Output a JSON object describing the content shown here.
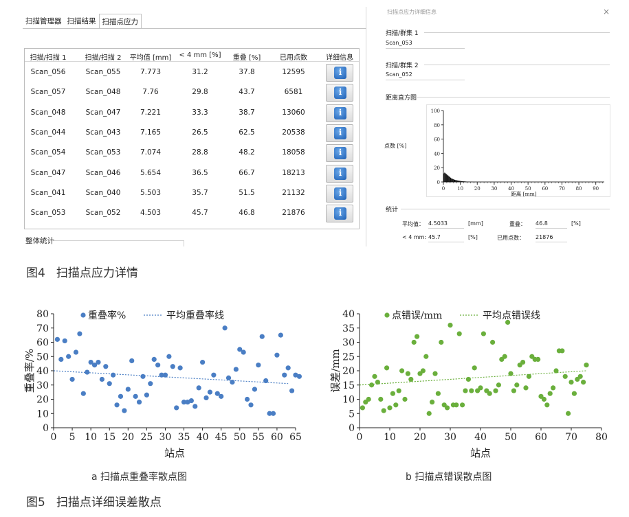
{
  "figure4": {
    "tabs": [
      "扫描管理器",
      "扫描结果",
      "扫描点应力"
    ],
    "active_tab": 2,
    "columns": [
      "扫描/扫描 1",
      "扫描/扫描 2",
      "平均值 [mm]",
      "< 4 mm [%]",
      "重叠 [%]",
      "已用点数",
      "详细信息"
    ],
    "rows": [
      {
        "scan1": "Scan_056",
        "scan2": "Scan_055",
        "mean": "7.773",
        "lt4": "31.2",
        "overlap": "37.8",
        "points": "12595"
      },
      {
        "scan1": "Scan_057",
        "scan2": "Scan_048",
        "mean": "7.76",
        "lt4": "29.8",
        "overlap": "43.7",
        "points": "6581"
      },
      {
        "scan1": "Scan_048",
        "scan2": "Scan_047",
        "mean": "7.221",
        "lt4": "33.3",
        "overlap": "38.7",
        "points": "13060"
      },
      {
        "scan1": "Scan_044",
        "scan2": "Scan_043",
        "mean": "7.165",
        "lt4": "26.5",
        "overlap": "62.5",
        "points": "20538"
      },
      {
        "scan1": "Scan_054",
        "scan2": "Scan_053",
        "mean": "7.074",
        "lt4": "28.8",
        "overlap": "48.2",
        "points": "18058"
      },
      {
        "scan1": "Scan_047",
        "scan2": "Scan_046",
        "mean": "5.654",
        "lt4": "36.5",
        "overlap": "66.7",
        "points": "18213"
      },
      {
        "scan1": "Scan_041",
        "scan2": "Scan_040",
        "mean": "5.503",
        "lt4": "35.7",
        "overlap": "51.5",
        "points": "21132"
      },
      {
        "scan1": "Scan_053",
        "scan2": "Scan_052",
        "mean": "4.503",
        "lt4": "45.7",
        "overlap": "46.8",
        "points": "21876"
      }
    ],
    "info_glyph": "i",
    "overall_stats_label": "整体统计",
    "detail": {
      "window_title": "扫描点应力详细信息",
      "close_glyph": "×",
      "scan1_label": "扫描/群集 1",
      "scan1_value": "Scan_053",
      "scan2_label": "扫描/群集 2",
      "scan2_value": "Scan_052",
      "histogram_label": "距离直方图",
      "histogram": {
        "ylabel": "点数 [%]",
        "xlabel": "距离 [mm]",
        "yticks": [
          "0",
          "20",
          "40",
          "60",
          "80",
          "100"
        ],
        "xticks": [
          "0",
          "10",
          "20",
          "30",
          "40",
          "50",
          "60",
          "70",
          "80",
          "90"
        ],
        "x_range": [
          0,
          95
        ],
        "y_range": [
          0,
          100
        ],
        "bin_width_mm": 0.5,
        "values": [
          12,
          13,
          12,
          11,
          10,
          9,
          8,
          7,
          6,
          5,
          4.5,
          4,
          3.5,
          3,
          2.7,
          2.4,
          2.1,
          1.9,
          1.7,
          1.5,
          1.3,
          1.1,
          1,
          0.9,
          0.8,
          0.7,
          0.6,
          0.5,
          0.45,
          0.4,
          0.35,
          0.3,
          0.25,
          0.2,
          0.15,
          0.1
        ]
      },
      "stats_label": "统计",
      "mean_label": "平均值：",
      "mean_value": "4.5033",
      "mean_unit": "[mm]",
      "overlap_label": "重叠：",
      "overlap_value": "46.8",
      "overlap_unit": "[%]",
      "lt4_label": "< 4 mm:",
      "lt4_value": "45.7",
      "lt4_unit": "[%]",
      "points_label": "已用点数：",
      "points_value": "21876"
    },
    "caption_num": "图4",
    "caption_text": "扫描点应力详情"
  },
  "chart_data": [
    {
      "type": "scatter",
      "xlabel": "站点",
      "ylabel": "重叠率/%",
      "xlim": [
        0,
        65
      ],
      "ylim": [
        0,
        80
      ],
      "xticks": [
        0,
        5,
        10,
        15,
        20,
        25,
        30,
        35,
        40,
        45,
        50,
        55,
        60,
        65
      ],
      "yticks": [
        0,
        10,
        20,
        30,
        40,
        50,
        60,
        70,
        80
      ],
      "legend": [
        "重叠率%",
        "平均重叠率线"
      ],
      "legend_position": "top",
      "point_color": "#4a7ec4",
      "trend": {
        "x": [
          0,
          63
        ],
        "y": [
          40,
          31
        ]
      },
      "points": [
        [
          1,
          62
        ],
        [
          2,
          48
        ],
        [
          3,
          61
        ],
        [
          4,
          50
        ],
        [
          5,
          34
        ],
        [
          6,
          53
        ],
        [
          7,
          66
        ],
        [
          8,
          24
        ],
        [
          9,
          39
        ],
        [
          10,
          46
        ],
        [
          11,
          44
        ],
        [
          12,
          46
        ],
        [
          13,
          34
        ],
        [
          14,
          43
        ],
        [
          15,
          31
        ],
        [
          16,
          37
        ],
        [
          17,
          16
        ],
        [
          18,
          22
        ],
        [
          19,
          12
        ],
        [
          20,
          27
        ],
        [
          21,
          47
        ],
        [
          22,
          22
        ],
        [
          23,
          18
        ],
        [
          24,
          36
        ],
        [
          25,
          23
        ],
        [
          26,
          31
        ],
        [
          27,
          48
        ],
        [
          28,
          44
        ],
        [
          29,
          37
        ],
        [
          30,
          37
        ],
        [
          31,
          50
        ],
        [
          32,
          43
        ],
        [
          33,
          14
        ],
        [
          34,
          42
        ],
        [
          35,
          18
        ],
        [
          36,
          18
        ],
        [
          37,
          19
        ],
        [
          38,
          15
        ],
        [
          39,
          28
        ],
        [
          40,
          46
        ],
        [
          41,
          21
        ],
        [
          42,
          25
        ],
        [
          43,
          37
        ],
        [
          44,
          24
        ],
        [
          45,
          22
        ],
        [
          46,
          70
        ],
        [
          47,
          35
        ],
        [
          48,
          32
        ],
        [
          49,
          41
        ],
        [
          50,
          55
        ],
        [
          51,
          53
        ],
        [
          52,
          20
        ],
        [
          53,
          16
        ],
        [
          54,
          27
        ],
        [
          55,
          44
        ],
        [
          56,
          64
        ],
        [
          57,
          33
        ],
        [
          58,
          10
        ],
        [
          59,
          10
        ],
        [
          60,
          51
        ],
        [
          61,
          65
        ],
        [
          62,
          37
        ],
        [
          63,
          42
        ],
        [
          64,
          26
        ],
        [
          65,
          37
        ],
        [
          66,
          36
        ]
      ]
    },
    {
      "type": "scatter",
      "xlabel": "站点",
      "ylabel": "误差/mm",
      "xlim": [
        0,
        80
      ],
      "ylim": [
        0,
        40
      ],
      "xticks": [
        0,
        10,
        20,
        30,
        40,
        50,
        60,
        70,
        80
      ],
      "yticks": [
        0,
        5,
        10,
        15,
        20,
        25,
        30,
        35,
        40
      ],
      "legend": [
        "点错误/mm",
        "平均点错误线"
      ],
      "legend_position": "top",
      "point_color": "#6aaf3c",
      "trend": {
        "x": [
          0,
          75
        ],
        "y": [
          15,
          20
        ]
      },
      "points": [
        [
          1,
          7
        ],
        [
          2,
          9
        ],
        [
          3,
          10
        ],
        [
          4,
          15
        ],
        [
          5,
          18
        ],
        [
          6,
          16
        ],
        [
          7,
          10
        ],
        [
          8,
          6
        ],
        [
          9,
          21
        ],
        [
          10,
          7
        ],
        [
          11,
          12
        ],
        [
          12,
          8
        ],
        [
          13,
          13
        ],
        [
          14,
          20
        ],
        [
          15,
          10
        ],
        [
          16,
          19
        ],
        [
          17,
          17
        ],
        [
          18,
          30
        ],
        [
          19,
          32
        ],
        [
          20,
          19
        ],
        [
          21,
          20
        ],
        [
          22,
          25
        ],
        [
          23,
          5
        ],
        [
          24,
          9
        ],
        [
          25,
          19
        ],
        [
          26,
          12
        ],
        [
          27,
          30
        ],
        [
          28,
          8
        ],
        [
          29,
          7
        ],
        [
          30,
          36
        ],
        [
          31,
          8
        ],
        [
          32,
          8
        ],
        [
          33,
          33
        ],
        [
          34,
          8
        ],
        [
          35,
          13
        ],
        [
          36,
          17
        ],
        [
          37,
          13
        ],
        [
          38,
          21
        ],
        [
          39,
          13
        ],
        [
          40,
          14
        ],
        [
          41,
          33
        ],
        [
          42,
          13
        ],
        [
          43,
          12
        ],
        [
          44,
          30
        ],
        [
          45,
          13
        ],
        [
          46,
          15
        ],
        [
          47,
          24
        ],
        [
          48,
          25
        ],
        [
          49,
          37
        ],
        [
          50,
          19
        ],
        [
          51,
          13
        ],
        [
          52,
          15
        ],
        [
          53,
          22
        ],
        [
          54,
          23
        ],
        [
          55,
          14
        ],
        [
          56,
          18
        ],
        [
          57,
          25
        ],
        [
          58,
          24
        ],
        [
          59,
          24
        ],
        [
          60,
          11
        ],
        [
          61,
          10
        ],
        [
          62,
          8
        ],
        [
          63,
          12
        ],
        [
          64,
          14
        ],
        [
          65,
          20
        ],
        [
          66,
          27
        ],
        [
          67,
          27
        ],
        [
          68,
          18
        ],
        [
          69,
          5
        ],
        [
          70,
          16
        ],
        [
          71,
          12
        ],
        [
          72,
          17
        ],
        [
          73,
          18
        ],
        [
          74,
          16
        ],
        [
          75,
          22
        ]
      ]
    }
  ],
  "figure5": {
    "sub_a": "a 扫描点重叠率散点图",
    "sub_b": "b 扫描点错误散点图",
    "caption_num": "图5",
    "caption_text": "扫描点详细误差散点"
  }
}
